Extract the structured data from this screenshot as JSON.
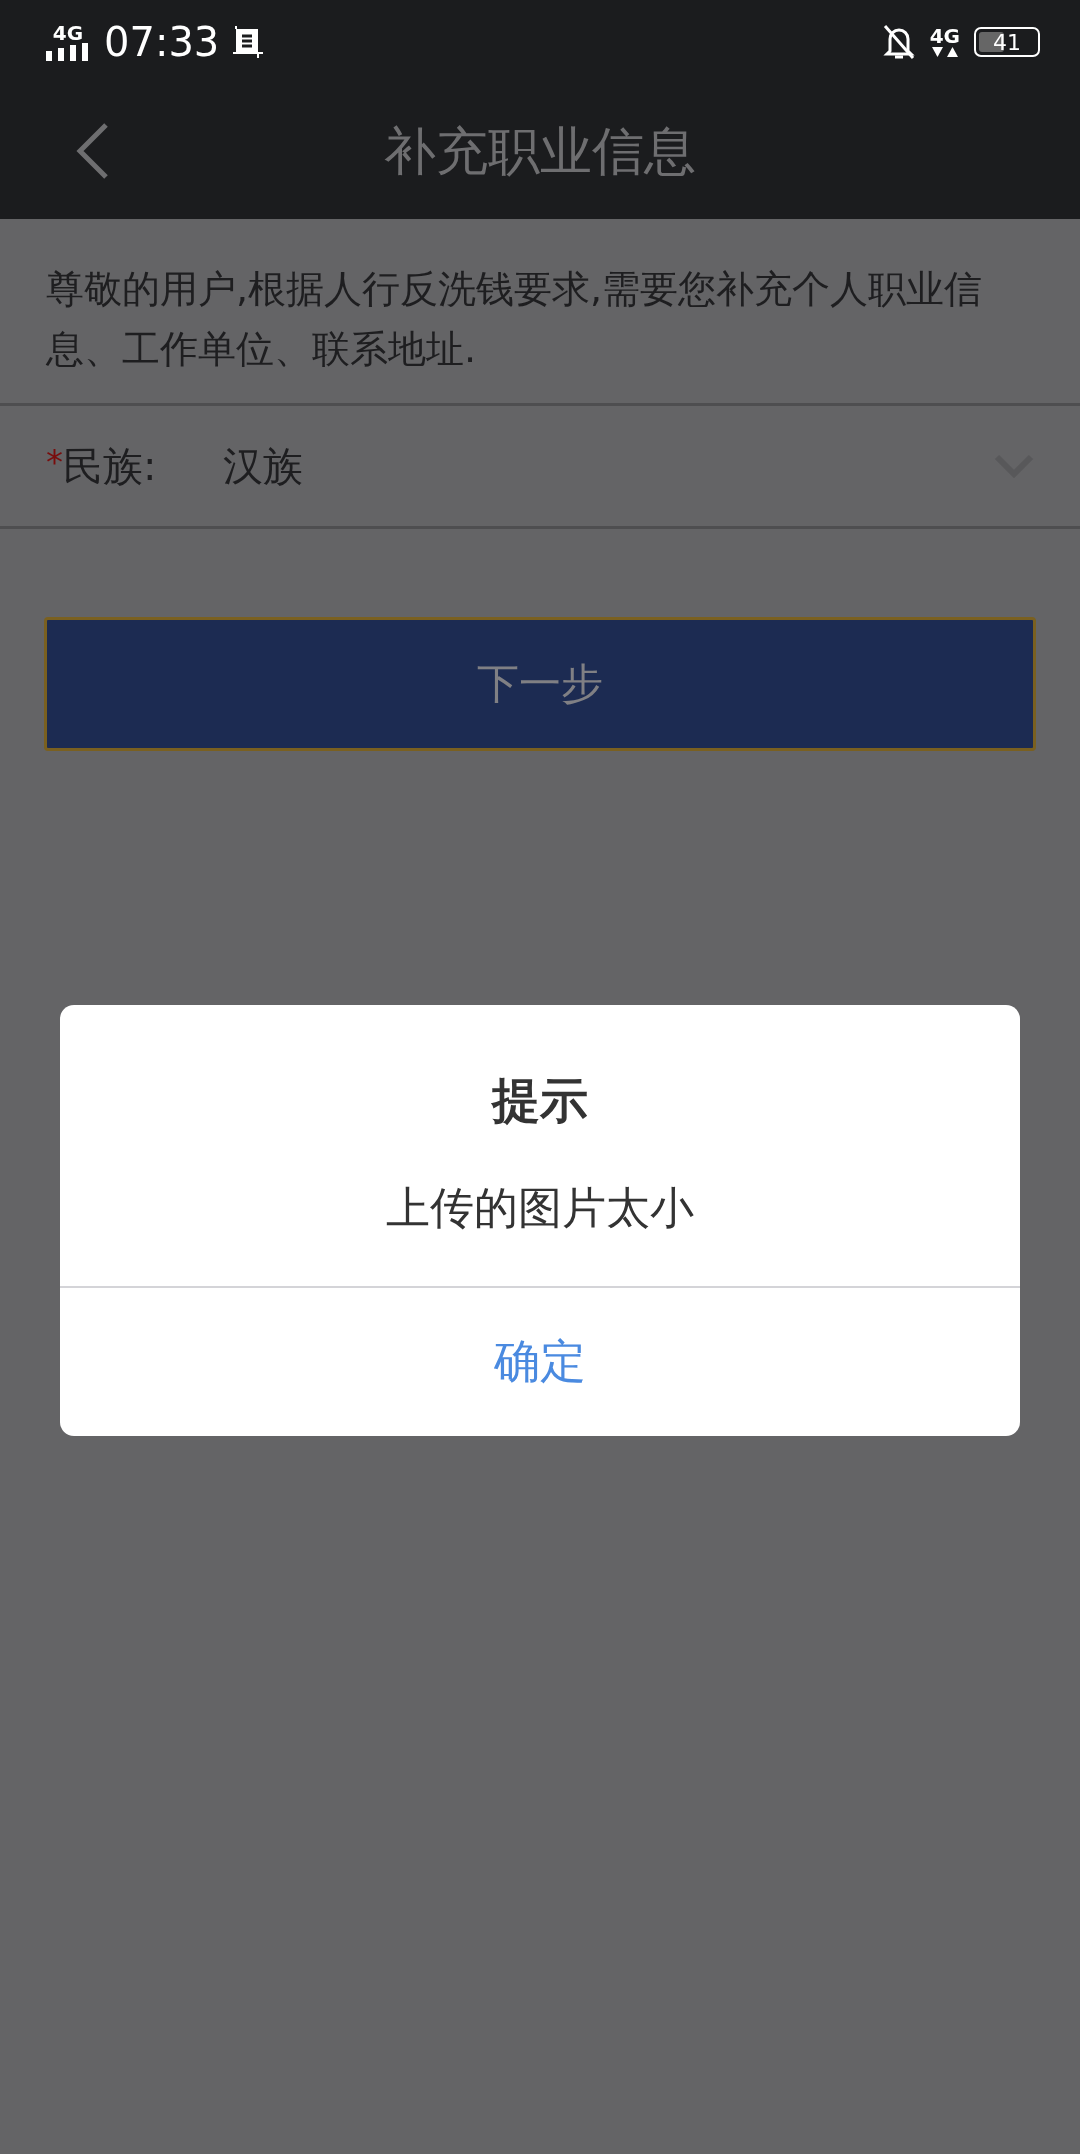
{
  "status_bar": {
    "left_network": "4G",
    "time": "07:33",
    "right_network": "4G",
    "battery": "41"
  },
  "header": {
    "title": "补充职业信息"
  },
  "notice": "尊敬的用户,根据人行反洗钱要求,需要您补充个人职业信息、工作单位、联系地址.",
  "field": {
    "required_mark": "*",
    "label": "民族:",
    "value": "汉族"
  },
  "next_button": "下一步",
  "dialog": {
    "title": "提示",
    "message": "上传的图片太小",
    "confirm": "确定"
  }
}
